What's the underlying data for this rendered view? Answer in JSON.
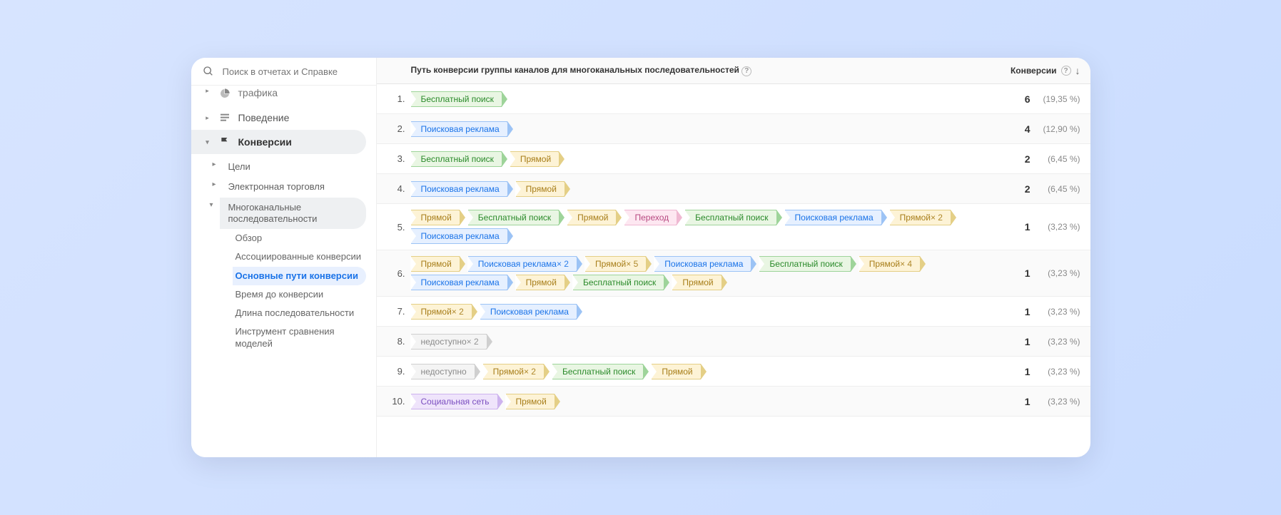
{
  "search": {
    "placeholder": "Поиск в отчетах и Справке"
  },
  "sidebar": {
    "truncated_top": "трафика",
    "behavior": "Поведение",
    "conversions": "Конверсии",
    "sub": {
      "goals": "Цели",
      "ecommerce": "Электронная торговля",
      "multichannel": "Многоканальные последовательности"
    },
    "leaves": {
      "overview": "Обзор",
      "assisted": "Ассоциированные конверсии",
      "top_paths": "Основные пути конверсии",
      "time_lag": "Время до конверсии",
      "path_length": "Длина последовательности",
      "model_compare": "Инструмент сравнения моделей"
    }
  },
  "headers": {
    "path": "Путь конверсии группы каналов для многоканальных последовательностей",
    "conversions": "Конверсии"
  },
  "channels": {
    "organic": "Бесплатный поиск",
    "paid": "Поисковая реклама",
    "direct": "Прямой",
    "referral": "Переход",
    "social": "Социальная сеть",
    "unavailable": "недоступно"
  },
  "rows": [
    {
      "n": "1.",
      "path": [
        {
          "c": "organic"
        }
      ],
      "conv": "6",
      "pct": "(19,35 %)"
    },
    {
      "n": "2.",
      "path": [
        {
          "c": "paid"
        }
      ],
      "conv": "4",
      "pct": "(12,90 %)"
    },
    {
      "n": "3.",
      "path": [
        {
          "c": "organic"
        },
        {
          "c": "direct"
        }
      ],
      "conv": "2",
      "pct": "(6,45 %)"
    },
    {
      "n": "4.",
      "path": [
        {
          "c": "paid"
        },
        {
          "c": "direct"
        }
      ],
      "conv": "2",
      "pct": "(6,45 %)"
    },
    {
      "n": "5.",
      "path": [
        {
          "c": "direct"
        },
        {
          "c": "organic"
        },
        {
          "c": "direct"
        },
        {
          "c": "referral"
        },
        {
          "c": "organic"
        },
        {
          "c": "paid"
        },
        {
          "c": "direct",
          "x": "2"
        },
        {
          "c": "paid"
        }
      ],
      "conv": "1",
      "pct": "(3,23 %)"
    },
    {
      "n": "6.",
      "path": [
        {
          "c": "direct"
        },
        {
          "c": "paid",
          "x": "2"
        },
        {
          "c": "direct",
          "x": "5"
        },
        {
          "c": "paid"
        },
        {
          "c": "organic"
        },
        {
          "c": "direct",
          "x": "4"
        },
        {
          "c": "paid"
        },
        {
          "c": "direct"
        },
        {
          "c": "organic"
        },
        {
          "c": "direct"
        }
      ],
      "conv": "1",
      "pct": "(3,23 %)"
    },
    {
      "n": "7.",
      "path": [
        {
          "c": "direct",
          "x": "2"
        },
        {
          "c": "paid"
        }
      ],
      "conv": "1",
      "pct": "(3,23 %)"
    },
    {
      "n": "8.",
      "path": [
        {
          "c": "unavailable",
          "x": "2"
        }
      ],
      "conv": "1",
      "pct": "(3,23 %)"
    },
    {
      "n": "9.",
      "path": [
        {
          "c": "unavailable"
        },
        {
          "c": "direct",
          "x": "2"
        },
        {
          "c": "organic"
        },
        {
          "c": "direct"
        }
      ],
      "conv": "1",
      "pct": "(3,23 %)"
    },
    {
      "n": "10.",
      "path": [
        {
          "c": "social"
        },
        {
          "c": "direct"
        }
      ],
      "conv": "1",
      "pct": "(3,23 %)"
    }
  ]
}
